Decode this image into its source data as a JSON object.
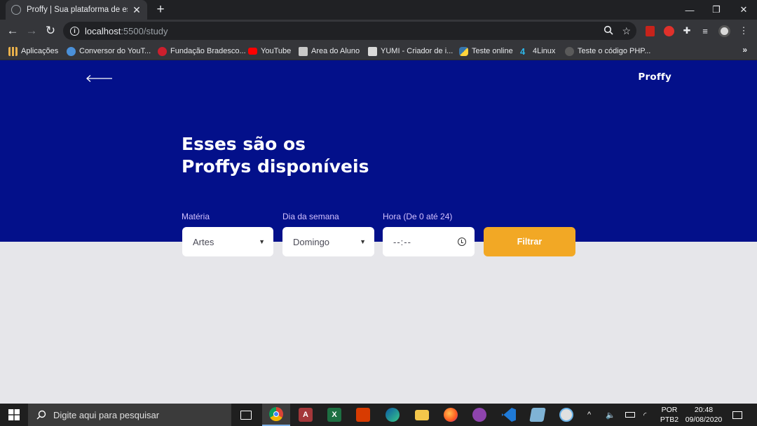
{
  "browser": {
    "tab_title": "Proffy | Sua plataforma de estudos online",
    "url_host": "localhost",
    "url_path": ":5500/study",
    "window_controls": {
      "minimize": "—",
      "restore": "❐",
      "close": "✕"
    }
  },
  "bookmarks": [
    {
      "label": "Aplicações",
      "icon_color": "#e8b04b"
    },
    {
      "label": "Conversor do YouT...",
      "icon_color": "#4a90d9"
    },
    {
      "label": "Fundação Bradesco...",
      "icon_color": "#cc1f2d"
    },
    {
      "label": "YouTube",
      "icon_color": "#ff0000"
    },
    {
      "label": "Area do Aluno",
      "icon_color": "#c8c8c8"
    },
    {
      "label": "YUMI - Criador de i...",
      "icon_color": "#d9d9d9"
    },
    {
      "label": "Teste online",
      "icon_color": "#3776ab"
    },
    {
      "label": "4Linux",
      "icon_color": "#2db6e8"
    },
    {
      "label": "Teste o código PHP...",
      "icon_color": "#5a5a5a"
    }
  ],
  "bookmarks_overflow": "»",
  "page": {
    "logo": "Proffy",
    "headline_line1": "Esses são os",
    "headline_line2": "Proffys disponíveis",
    "colors": {
      "primary": "#03108a",
      "secondary": "#f2a825",
      "background": "#e6e6ea",
      "label": "#d4c2ff"
    },
    "filters": {
      "subject": {
        "label": "Matéria",
        "value": "Artes"
      },
      "weekday": {
        "label": "Dia da semana",
        "value": "Domingo"
      },
      "time": {
        "label": "Hora (De 0 até 24)",
        "value": "--:--"
      },
      "button_label": "Filtrar"
    }
  },
  "taskbar": {
    "search_placeholder": "Digite aqui para pesquisar",
    "apps": [
      "task-view",
      "chrome",
      "access",
      "excel",
      "office",
      "edge",
      "file-explorer",
      "firefox",
      "github-desktop",
      "vscode",
      "notebook-app",
      "paint-app"
    ],
    "language": "POR",
    "keyboard": "PTB2",
    "time": "20:48",
    "date": "09/08/2020"
  }
}
